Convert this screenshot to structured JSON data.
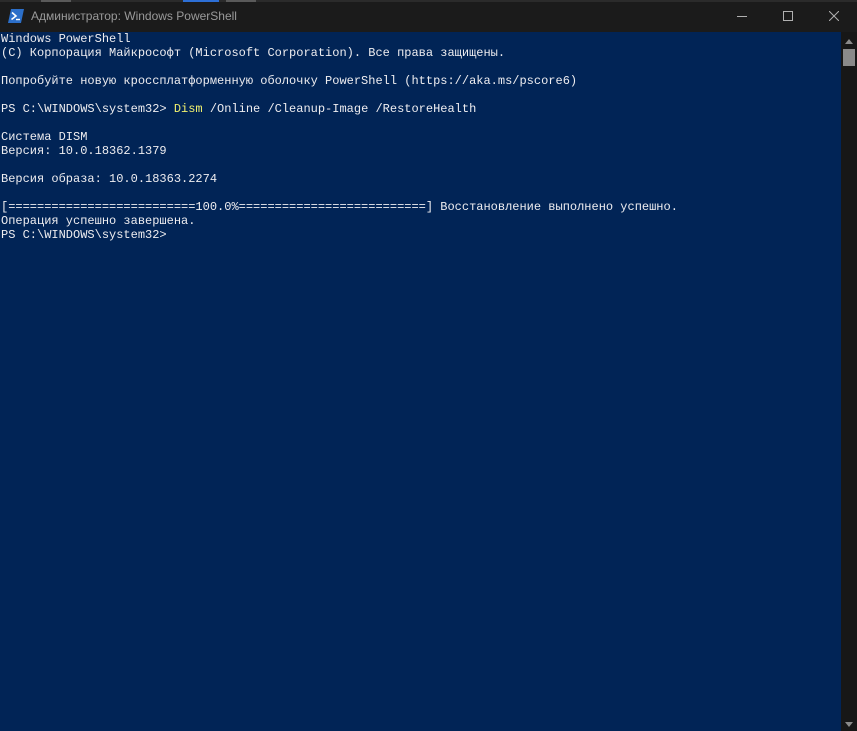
{
  "window": {
    "title": "Администратор: Windows PowerShell",
    "buttons": {
      "minimize": "minimize",
      "maximize": "maximize",
      "close": "close"
    }
  },
  "colors": {
    "console_bg": "#012456",
    "console_fg": "#eeedf0",
    "command_highlight": "#f0f06e",
    "titlebar_bg": "#1b1b1b"
  },
  "console": {
    "header_line1": "Windows PowerShell",
    "header_line2": "(C) Корпорация Майкрософт (Microsoft Corporation). Все права защищены.",
    "promo_line": "Попробуйте новую кроссплатформенную оболочку PowerShell (https://aka.ms/pscore6)",
    "prompt1": "PS C:\\WINDOWS\\system32> ",
    "command_exe": "Dism",
    "command_args": " /Online /Cleanup-Image /RestoreHealth",
    "tool_name": "Система DISM",
    "tool_version": "Версия: 10.0.18362.1379",
    "image_version": "Версия образа: 10.0.18363.2274",
    "progress_line": "[==========================100.0%==========================] Восстановление выполнено успешно.",
    "result_line": "Операция успешно завершена.",
    "prompt2": "PS C:\\WINDOWS\\system32>"
  },
  "icons": {
    "app": "powershell-icon",
    "minimize": "minimize-icon",
    "maximize": "maximize-icon",
    "close": "close-icon",
    "scroll_up": "chevron-up-icon",
    "scroll_down": "chevron-down-icon"
  }
}
